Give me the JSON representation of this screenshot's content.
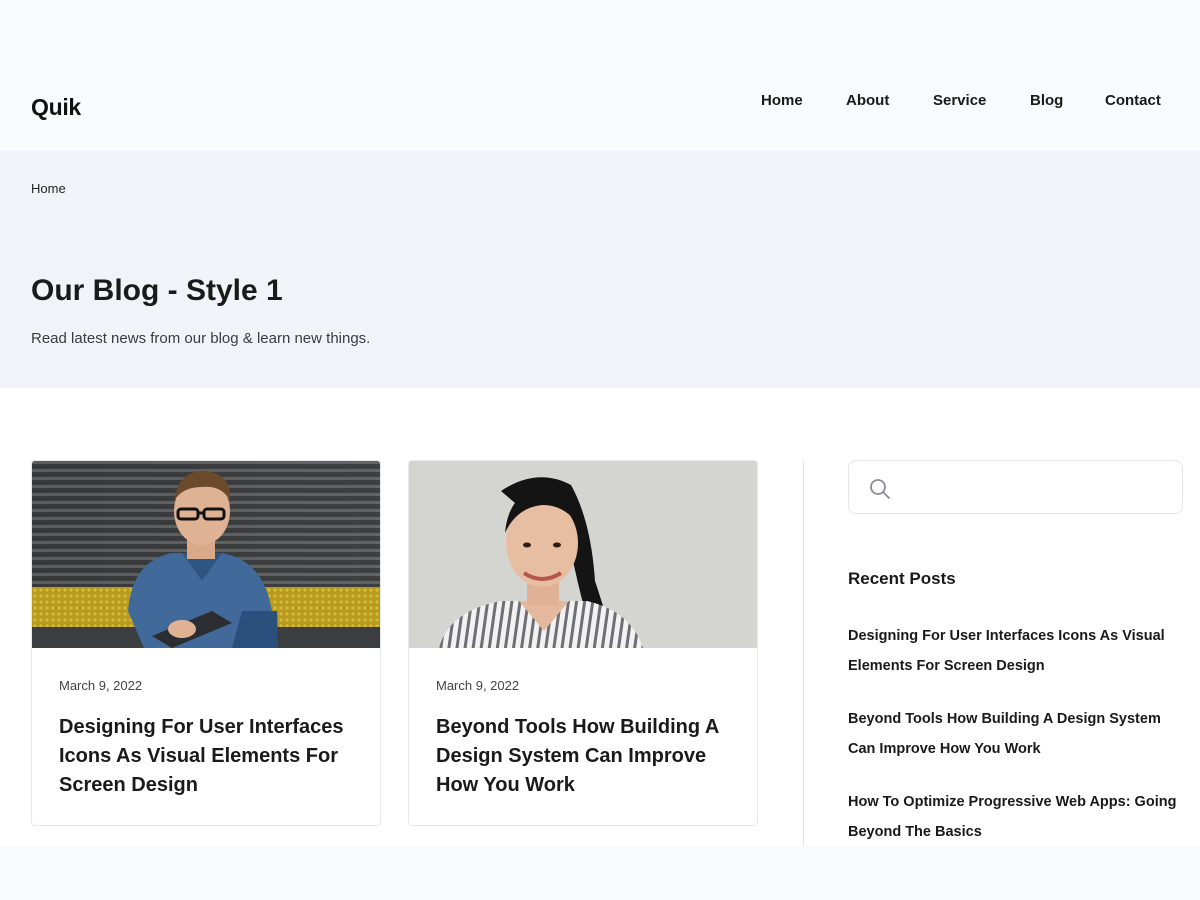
{
  "header": {
    "logo": "Quik",
    "nav": [
      "Home",
      "About",
      "Service",
      "Blog",
      "Contact"
    ]
  },
  "banner": {
    "breadcrumb": "Home",
    "title": "Our Blog - Style 1",
    "subtitle": "Read latest news from our blog & learn new things."
  },
  "posts": [
    {
      "date": "March 9, 2022",
      "title": "Designing For User Interfaces Icons As Visual Elements For Screen Design",
      "image": "man-with-glasses-writing-on-sofa-photo"
    },
    {
      "date": "March 9, 2022",
      "title": "Beyond Tools How Building A Design System Can Improve How You Work",
      "image": "smiling-woman-striped-shirt-photo"
    }
  ],
  "sidebar": {
    "search": {
      "value": "",
      "placeholder": "",
      "icon": "search-icon"
    },
    "recent_title": "Recent Posts",
    "recent": [
      "Designing For User Interfaces Icons As Visual Elements For Screen Design",
      "Beyond Tools How Building A Design System Can Improve How You Work",
      "How To Optimize Progressive Web Apps: Going Beyond The Basics"
    ]
  },
  "colors": {
    "page_bg": "#f9fafd",
    "banner_bg": "#f2f3f8",
    "text": "#1a1a1a",
    "border": "#e6e8ee"
  }
}
